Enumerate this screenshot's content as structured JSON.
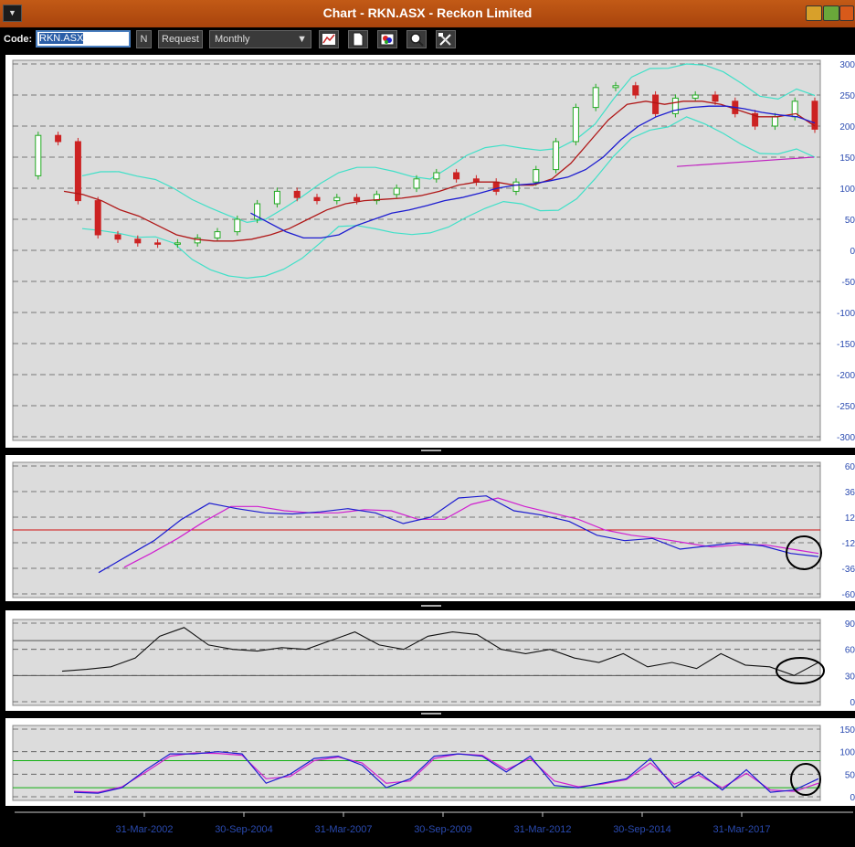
{
  "window": {
    "title": "Chart - RKN.ASX - Reckon Limited"
  },
  "toolbar": {
    "code_label": "Code:",
    "code_value": "RKN.ASX",
    "n_label": "N",
    "request_label": "Request",
    "interval_value": "Monthly"
  },
  "x_axis": {
    "labels": [
      "31-Mar-2002",
      "30-Sep-2004",
      "31-Mar-2007",
      "30-Sep-2009",
      "31-Mar-2012",
      "30-Sep-2014",
      "31-Mar-2017"
    ]
  },
  "colors": {
    "price_up": "#22aa22",
    "price_down": "#cc2222",
    "ma_fast": "#b01818",
    "ma_slow": "#1c1cd0",
    "bollinger": "#40e0c8",
    "macd": "#1c1cd0",
    "signal": "#d020d0",
    "zero_line": "#d01010",
    "rsi": "#111111",
    "stoch_k": "#1c1cd0",
    "stoch_d": "#d020d0",
    "bands": "#10b010",
    "circle": "#000000"
  },
  "chart_data": [
    {
      "type": "line",
      "ylim": [
        -300,
        300
      ],
      "yticks": [
        "300",
        "250",
        "200",
        "150",
        "100",
        "50",
        "0",
        "-50",
        "-100",
        "-150",
        "-200",
        "-250",
        "-300"
      ],
      "x": [
        0,
        5,
        10,
        15,
        20,
        25,
        30,
        35,
        40,
        45,
        50,
        55,
        60,
        65,
        70,
        75,
        80,
        85,
        90,
        95,
        100,
        105,
        110,
        115,
        120,
        125,
        130,
        135,
        140,
        145,
        150,
        155,
        160,
        165,
        170,
        175,
        180,
        185,
        190,
        195,
        200
      ],
      "series": [
        {
          "values": [
            120,
            185,
            175,
            80,
            25,
            18,
            12,
            10,
            12,
            20,
            30,
            50,
            75,
            95,
            85,
            80,
            85,
            80,
            90,
            100,
            115,
            125,
            115,
            110,
            95,
            110,
            130,
            175,
            230,
            262,
            265,
            250,
            220,
            245,
            250,
            240,
            220,
            200,
            215,
            240,
            195
          ]
        },
        {
          "values": [
            95,
            90,
            80,
            65,
            55,
            40,
            25,
            18,
            15,
            15,
            18,
            25,
            35,
            50,
            65,
            75,
            80,
            82,
            84,
            88,
            95,
            105,
            110,
            110,
            105,
            105,
            115,
            140,
            175,
            210,
            235,
            240,
            235,
            240,
            240,
            235,
            225,
            215,
            215,
            220,
            200
          ]
        },
        {
          "values": [
            null,
            null,
            null,
            null,
            null,
            null,
            null,
            null,
            60,
            45,
            30,
            20,
            20,
            25,
            40,
            50,
            60,
            65,
            72,
            80,
            85,
            92,
            100,
            105,
            107,
            112,
            118,
            130,
            150,
            178,
            200,
            215,
            225,
            230,
            232,
            232,
            228,
            222,
            218,
            215,
            205
          ]
        }
      ]
    },
    {
      "type": "line",
      "ylim": [
        -60,
        60
      ],
      "yticks": [
        "60",
        "36",
        "12",
        "-12",
        "-36",
        "-60"
      ],
      "series": [
        {
          "values": [
            -40,
            -25,
            -10,
            10,
            25,
            20,
            16,
            15,
            17,
            20,
            16,
            6,
            12,
            30,
            32,
            18,
            14,
            8,
            -5,
            -10,
            -8,
            -18,
            -15,
            -12,
            -15,
            -22,
            -25
          ]
        },
        {
          "values": [
            -35,
            -22,
            -8,
            8,
            22,
            22,
            18,
            16,
            16,
            19,
            18,
            10,
            10,
            24,
            30,
            22,
            16,
            10,
            0,
            -5,
            -8,
            -12,
            -16,
            -14,
            -14,
            -18,
            -22
          ]
        }
      ]
    },
    {
      "type": "line",
      "ylim": [
        0,
        90
      ],
      "yticks": [
        "90",
        "60",
        "30",
        "0"
      ],
      "series": [
        {
          "values": [
            35,
            37,
            40,
            50,
            75,
            85,
            65,
            60,
            58,
            62,
            60,
            70,
            80,
            65,
            60,
            75,
            80,
            77,
            60,
            55,
            60,
            50,
            45,
            55,
            40,
            45,
            38,
            55,
            42,
            40,
            30,
            45
          ]
        }
      ]
    },
    {
      "type": "line",
      "ylim": [
        0,
        150
      ],
      "yticks": [
        "150",
        "100",
        "50",
        "0"
      ],
      "series": [
        {
          "values": [
            10,
            8,
            20,
            60,
            95,
            95,
            100,
            95,
            30,
            50,
            85,
            90,
            70,
            20,
            40,
            90,
            95,
            90,
            55,
            90,
            25,
            20,
            30,
            40,
            85,
            20,
            55,
            15,
            60,
            10,
            15,
            40
          ]
        },
        {
          "values": [
            12,
            10,
            22,
            55,
            90,
            97,
            96,
            92,
            40,
            45,
            80,
            88,
            75,
            30,
            35,
            85,
            95,
            92,
            60,
            85,
            35,
            22,
            28,
            38,
            75,
            28,
            48,
            20,
            52,
            15,
            12,
            30
          ]
        }
      ]
    }
  ]
}
